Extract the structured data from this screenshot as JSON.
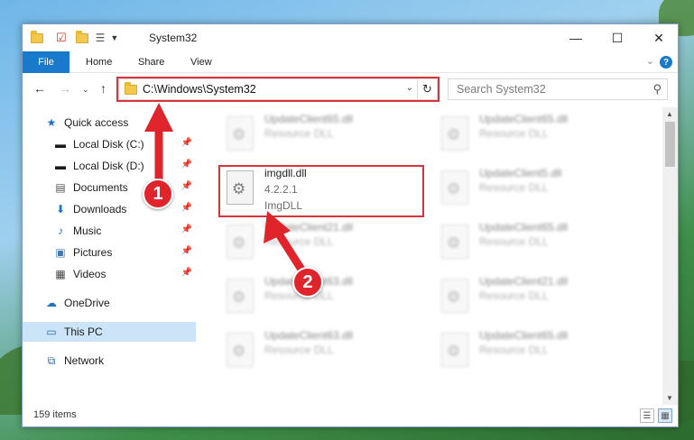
{
  "window": {
    "title": "System32",
    "controls": {
      "minimize": "—",
      "maximize": "☐",
      "close": "✕"
    }
  },
  "ribbon": {
    "file_tab": "File",
    "tabs": [
      "Home",
      "Share",
      "View"
    ],
    "help": "?"
  },
  "address_bar": {
    "path": "C:\\Windows\\System32",
    "search_placeholder": "Search System32"
  },
  "nav_pane": {
    "items": [
      {
        "label": "Quick access",
        "icon": "star-icon"
      },
      {
        "label": "Local Disk (C:)",
        "icon": "drive-icon"
      },
      {
        "label": "Local Disk (D:)",
        "icon": "drive-icon"
      },
      {
        "label": "Documents",
        "icon": "documents-icon"
      },
      {
        "label": "Downloads",
        "icon": "downloads-icon"
      },
      {
        "label": "Music",
        "icon": "music-icon"
      },
      {
        "label": "Pictures",
        "icon": "pictures-icon"
      },
      {
        "label": "Videos",
        "icon": "videos-icon"
      },
      {
        "label": "OneDrive",
        "icon": "cloud-icon"
      },
      {
        "label": "This PC",
        "icon": "computer-icon"
      },
      {
        "label": "Network",
        "icon": "network-icon"
      }
    ]
  },
  "files": {
    "left_column": [
      {
        "name": "UpdateClient65.dll",
        "type": "Resource DLL"
      },
      {
        "name": "imgdll.dll",
        "version": "4.2.2.1",
        "description": "ImgDLL"
      },
      {
        "name": "UpdateClient21.dll",
        "type": "Resource DLL"
      },
      {
        "name": "UpdateClient63.dll",
        "type": "Resource DLL"
      },
      {
        "name": "UpdateClient63.dll",
        "type": "Resource DLL"
      }
    ],
    "right_column": [
      {
        "name": "UpdateClient65.dll",
        "type": "Resource DLL"
      },
      {
        "name": "UpdateClient5.dll",
        "type": "Resource DLL"
      },
      {
        "name": "UpdateClient65.dll",
        "type": "Resource DLL"
      },
      {
        "name": "UpdateClient21.dll",
        "type": "Resource DLL"
      },
      {
        "name": "UpdateClient65.dll",
        "type": "Resource DLL"
      }
    ]
  },
  "status_bar": {
    "item_count": "159 items"
  },
  "callouts": {
    "step1": "1",
    "step2": "2",
    "color": "#e0242b"
  }
}
